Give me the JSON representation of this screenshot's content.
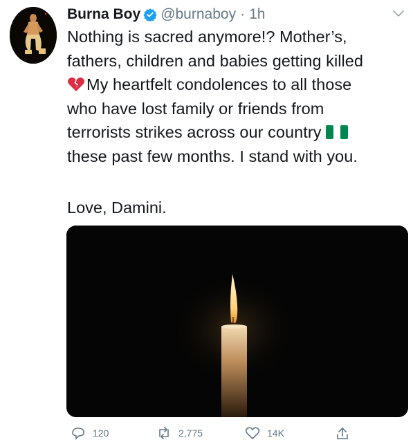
{
  "tweet": {
    "author_name": "Burna Boy",
    "handle": "@burnaboy",
    "separator": "·",
    "time": "1h",
    "lines": [
      "Nothing is sacred anymore!? Mother’s,",
      "fathers, children and babies getting killed",
      "My heartfelt condolences to all those",
      "who have lost family or friends from",
      "terrorists strikes across our country",
      "these past few months. I stand with you."
    ],
    "signoff": "Love, Damini.",
    "media_description_icon": "candle-image"
  },
  "actions": {
    "reply_count": "120",
    "retweet_count": "2,775",
    "like_count": "14K"
  },
  "icons": {
    "verified": "verified-badge-icon",
    "caret": "chevron-down-icon",
    "broken_heart": "broken-heart-emoji",
    "flag": "nigeria-flag-emoji",
    "reply": "reply-icon",
    "retweet": "retweet-icon",
    "like": "heart-icon",
    "share": "share-icon"
  },
  "colors": {
    "text": "#14171a",
    "muted": "#657786",
    "verified_blue": "#1da1f2",
    "broken_heart_red": "#dd2e44",
    "flag_green": "#008751"
  }
}
